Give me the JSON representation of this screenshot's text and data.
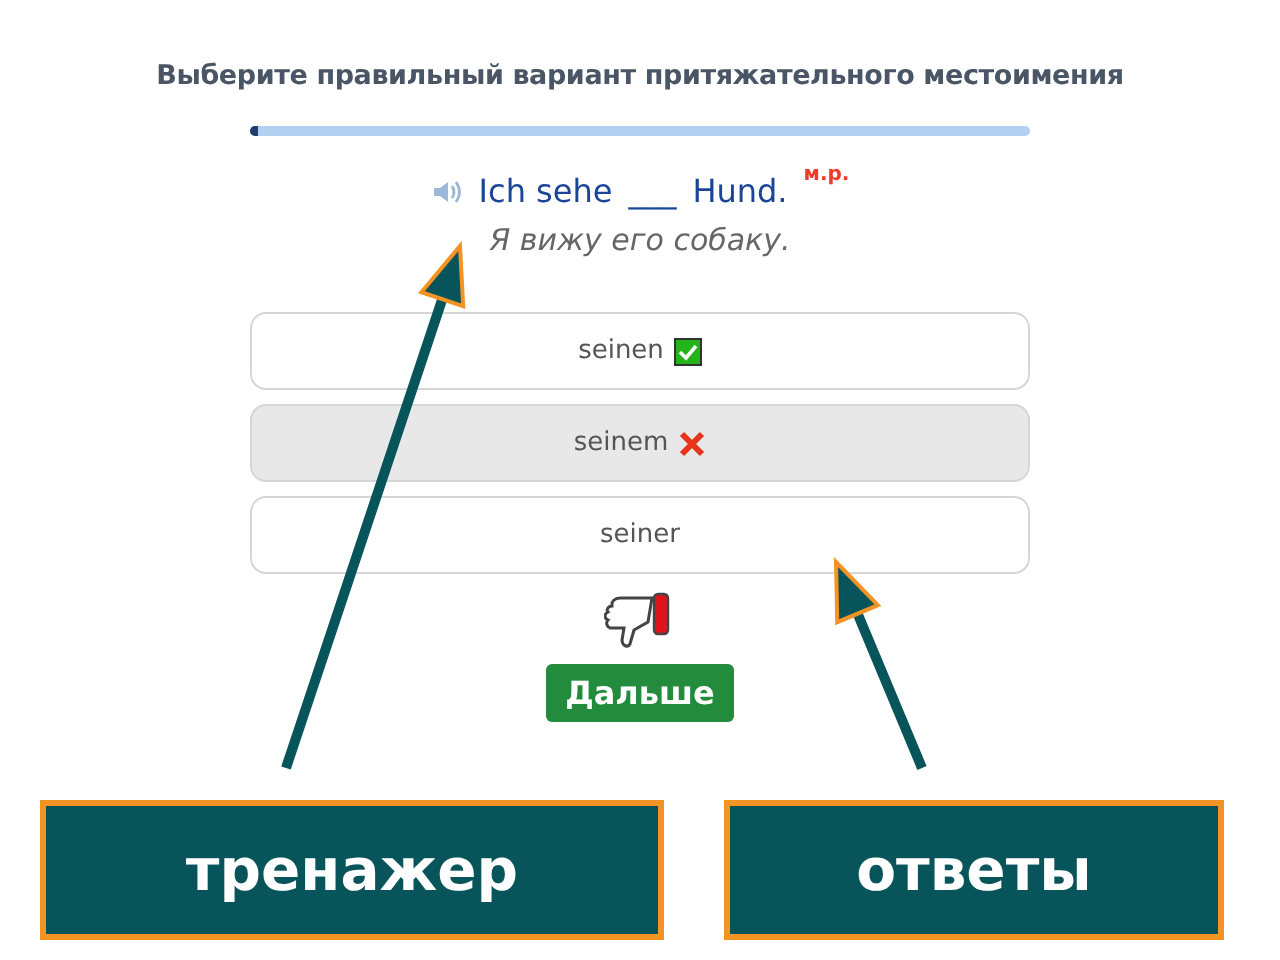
{
  "instruction": "Выберите правильный вариант притяжательного местоимения",
  "progress": {
    "level": 0.01
  },
  "sentence": {
    "before": "Ich sehe",
    "blank": "___",
    "after": "Hund.",
    "note": "м.р."
  },
  "translation": "Я вижу его собаку.",
  "options": [
    {
      "label": "seinen",
      "selected": false,
      "kind": "correct"
    },
    {
      "label": "seinem",
      "selected": true,
      "kind": "wrong"
    },
    {
      "label": "seiner",
      "selected": false,
      "kind": "plain"
    }
  ],
  "feedback": {
    "kind": "dislike"
  },
  "next_button": "Дальше",
  "callouts": [
    {
      "label": "тренажер"
    },
    {
      "label": "ответы"
    }
  ]
}
